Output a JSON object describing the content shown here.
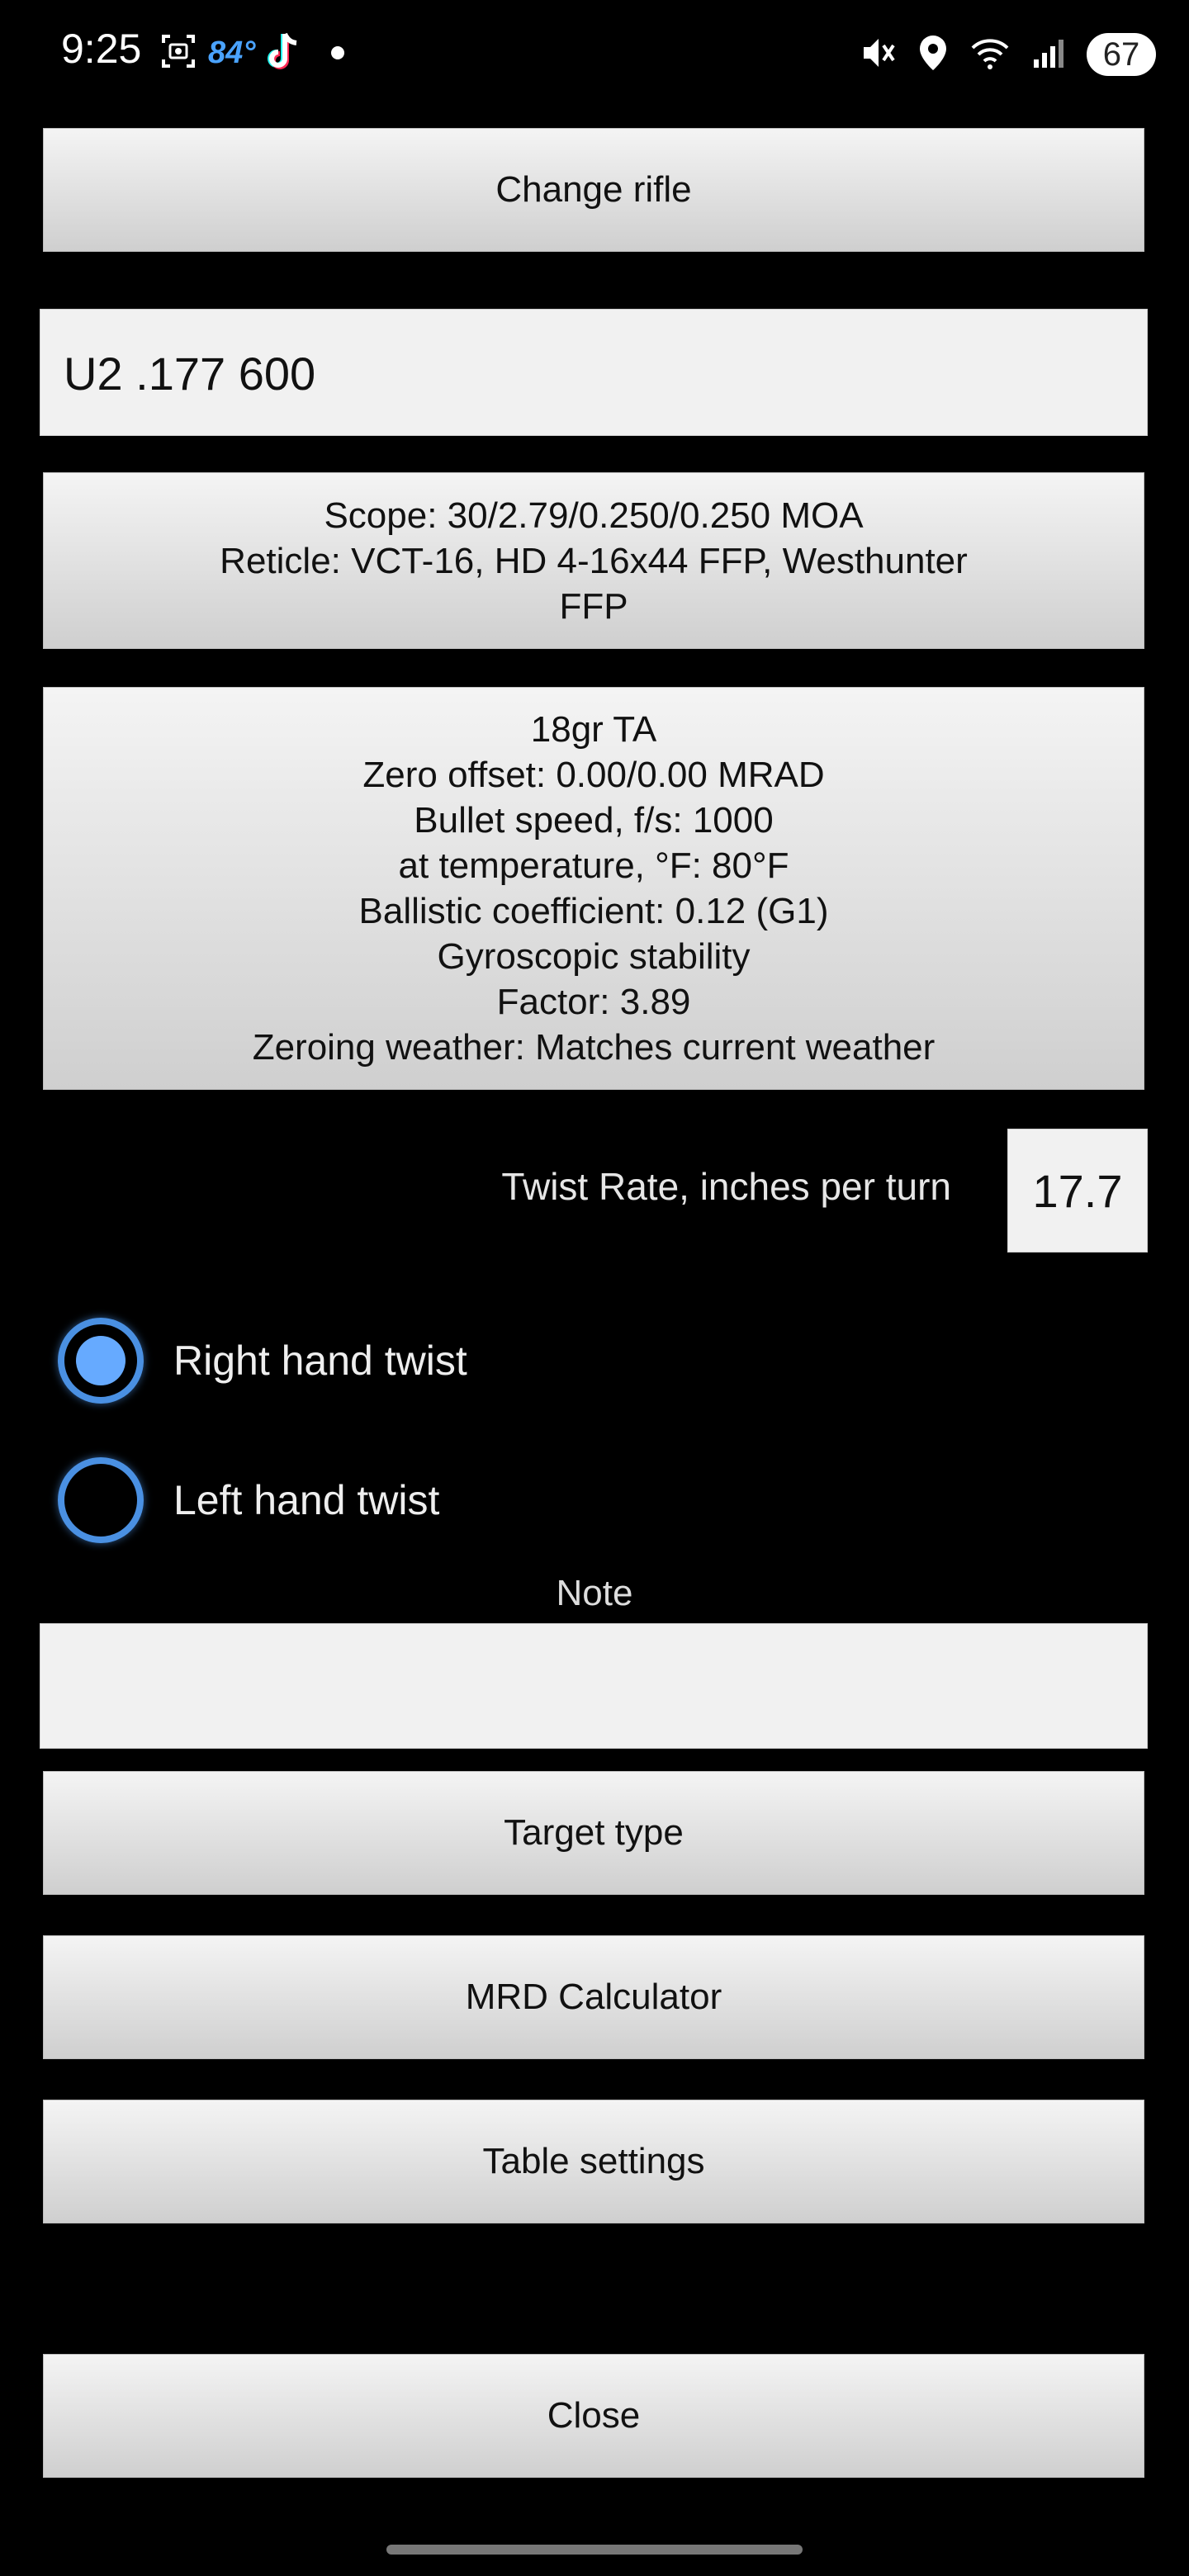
{
  "status_bar": {
    "time": "9:25",
    "weather_temp": "84°",
    "battery": "67",
    "icons": [
      "screenshot-icon",
      "tiktok-icon",
      "notification-dot",
      "mute-icon",
      "location-icon",
      "wifi-icon",
      "signal-icon"
    ]
  },
  "rifle": {
    "change_label": "Change rifle",
    "name": "U2 .177 600"
  },
  "scope": {
    "line1": "Scope: 30/2.79/0.250/0.250 MOA",
    "line2": "Reticle: VCT-16, HD 4-16x44 FFP, Westhunter",
    "line3": "FFP"
  },
  "bullet": {
    "line1": "18gr TA",
    "line2": "Zero offset: 0.00/0.00 MRAD",
    "line3": "Bullet speed, f/s: 1000",
    "line4": "at temperature, °F: 80°F",
    "line5": "Ballistic coefficient: 0.12 (G1)",
    "line6": "Gyroscopic stability",
    "line7": "Factor: 3.89",
    "line8": "Zeroing weather: Matches current weather"
  },
  "twist": {
    "label": "Twist Rate, inches per turn",
    "value": "17.7",
    "right_label": "Right hand twist",
    "left_label": "Left hand twist",
    "selected": "right"
  },
  "note": {
    "label": "Note",
    "value": ""
  },
  "buttons": {
    "target_type": "Target type",
    "mrd_calculator": "MRD Calculator",
    "table_settings": "Table settings",
    "close": "Close"
  },
  "colors": {
    "background": "#000000",
    "button_bg": "#e3e3e3",
    "radio_accent": "#4a90e2",
    "weather_accent": "#4aa3ff"
  }
}
